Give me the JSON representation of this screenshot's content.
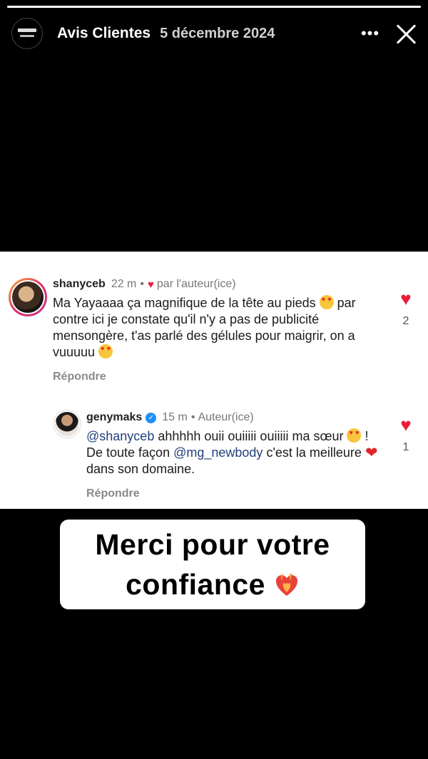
{
  "story": {
    "progress": 1.0,
    "title": "Avis Clientes",
    "date": "5 décembre 2024",
    "more_label": "•••"
  },
  "comments": [
    {
      "username": "shanyceb",
      "time": "22 m",
      "liked_by_author_label": "par l'auteur(ice)",
      "text_1": "Ma Yayaaaa ça magnifique de la tête au pieds ",
      "text_2": " par contre ici je constate qu'il n'y a pas de publicité mensongère, t'as parlé des gélules pour maigrir, on a vuuuuu ",
      "reply_label": "Répondre",
      "likes": "2"
    },
    {
      "username": "genymaks",
      "time": "15 m",
      "author_label": "Auteur(ice)",
      "mention_1": "@shanyceb",
      "text_1": " ahhhhh ouii ouiiiii ouiiiii ma sœur ",
      "text_2": " ! De toute façon ",
      "mention_2": "@mg_newbody",
      "text_3": " c'est la meilleure ",
      "text_4": " dans son domaine.",
      "reply_label": "Répondre",
      "likes": "1"
    }
  ],
  "sticker": {
    "line1": "Merci pour votre",
    "line2": "confiance"
  },
  "colors": {
    "like_red": "#ed1c3b",
    "mention_blue": "#23427c",
    "verified_blue": "#1d8ef5"
  }
}
